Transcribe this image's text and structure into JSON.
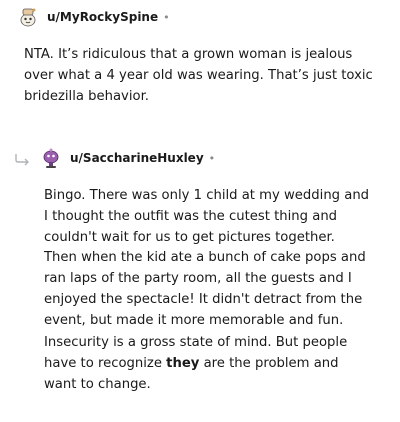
{
  "comment1": {
    "username": "u/MyRockySpine",
    "separator": "•",
    "body": "NTA. It’s ridiculous that a grown woman is jealous\nover what a 4 year old was wearing. That’s just toxic\nbridezilla behavior."
  },
  "comment2": {
    "username": "u/SaccharineHuxley",
    "separator": "•",
    "paragraph1": "Bingo. There was only 1 child at my wedding and\nI thought the outfit was the cutest thing and\ncouldn't wait for us to get pictures together.\nThen when the kid ate a bunch of cake pops and\nran laps of the party room, all the guests and I\nenjoyed the spectacle! It didn't detract from the\nevent, but made it more memorable and fun.",
    "paragraph2_before": "Insecurity is a gross state of mind. But people\nhave to recognize ",
    "paragraph2_bold": "they",
    "paragraph2_after": " are the problem and\nwant to change."
  }
}
